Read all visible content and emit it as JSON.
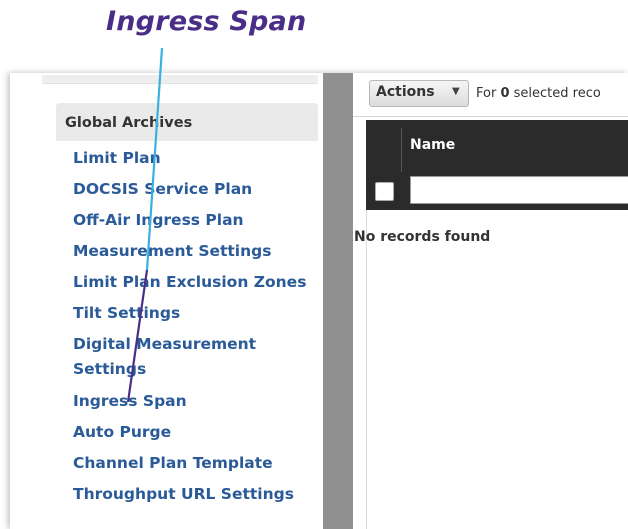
{
  "callout": {
    "text": "Ingress Span"
  },
  "sidebar": {
    "header": "Global Archives",
    "items": [
      {
        "label": "Limit Plan"
      },
      {
        "label": "DOCSIS Service Plan"
      },
      {
        "label": "Off-Air Ingress Plan"
      },
      {
        "label": "Measurement Settings"
      },
      {
        "label": "Limit Plan Exclusion Zones"
      },
      {
        "label": "Tilt Settings"
      },
      {
        "label": "Digital Measurement"
      },
      {
        "label": "Settings"
      },
      {
        "label": "Ingress Span"
      },
      {
        "label": "Auto Purge"
      },
      {
        "label": "Channel Plan Template"
      },
      {
        "label": "Throughput URL Settings"
      }
    ]
  },
  "toolbar": {
    "actions_label": "Actions",
    "selected_prefix": "For",
    "selected_count": "0",
    "selected_suffix": "selected reco"
  },
  "grid": {
    "columns": [
      "Name"
    ],
    "filter_value": "",
    "empty_message": "No records found"
  },
  "colors": {
    "callout": "#4a2d86",
    "link": "#2a5a98",
    "pointer_line_light": "#3ab0e0",
    "pointer_line_dark": "#4a2d86",
    "grid_header": "#2b2b2b"
  }
}
